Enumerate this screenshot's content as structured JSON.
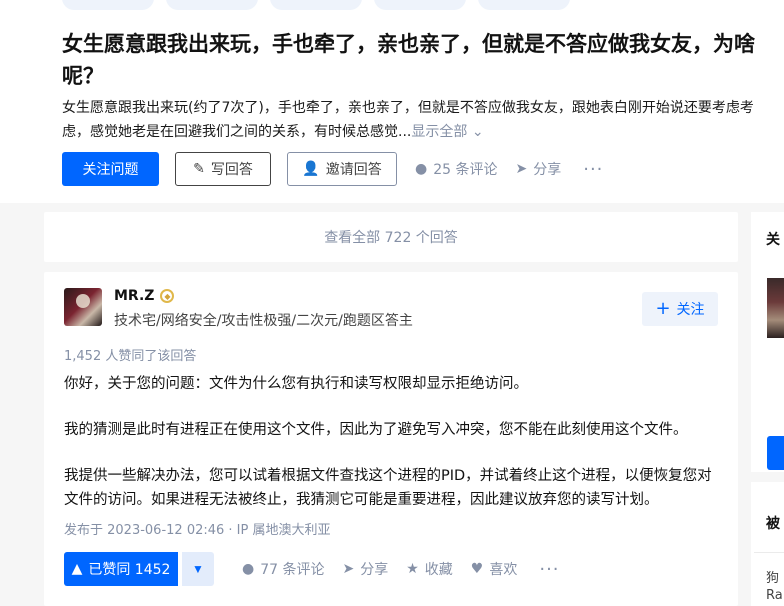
{
  "question": {
    "title": "女生愿意跟我出来玩，手也牵了，亲也亲了，但就是不答应做我女友，为啥呢？",
    "excerpt": "女生愿意跟我出来玩(约了7次了)，手也牵了，亲也亲了，但就是不答应做我女友，跟她表白刚开始说还要考虑考虑，感觉她老是在回避我们之间的关系，有时候总感觉...",
    "show_all": "显示全部",
    "follow_label": "关注问题",
    "write_label": "写回答",
    "invite_label": "邀请回答",
    "comments_label": "25 条评论",
    "share_label": "分享",
    "more_label": "···"
  },
  "view_all_label": "查看全部 722 个回答",
  "answer": {
    "author_name": "MR.Z",
    "author_bio": "技术宅/网络安全/攻击性极强/二次元/跑题区答主",
    "follow_label": "关注",
    "upvoted_by": "1,452 人赞同了该回答",
    "paragraphs": [
      "你好，关于您的问题：文件为什么您有执行和读写权限却显示拒绝访问。",
      "我的猜测是此时有进程正在使用这个文件，因此为了避免写入冲突，您不能在此刻使用这个文件。",
      "我提供一些解决办法，您可以试着根据文件查找这个进程的PID，并试着终止这个进程，以便恢复您对文件的访问。如果进程无法被终止，我猜测它可能是重要进程，因此建议放弃您的读写计划。"
    ],
    "published": "发布于 2023-06-12 02:46 · IP 属地澳大利亚",
    "upvote_label": "已赞同 1452",
    "comments_label": "77 条评论",
    "share_label": "分享",
    "collect_label": "收藏",
    "like_label": "喜欢",
    "more_label": "···"
  },
  "sidebar": {
    "title_top": "关",
    "title_bottom": "被",
    "line1": "狗",
    "line2": "Ra"
  },
  "colors": {
    "accent": "#0066ff",
    "muted": "#8590a6",
    "background": "#f6f6f6"
  },
  "icons": {
    "write": "pencil-icon",
    "invite": "person-plus-icon",
    "comment": "comment-bubble-icon",
    "share": "paper-plane-icon",
    "collect": "star-icon",
    "like": "heart-icon",
    "upvote": "triangle-up-icon",
    "downvote": "triangle-down-icon",
    "follow": "plus-icon",
    "badge": "badge-icon"
  }
}
